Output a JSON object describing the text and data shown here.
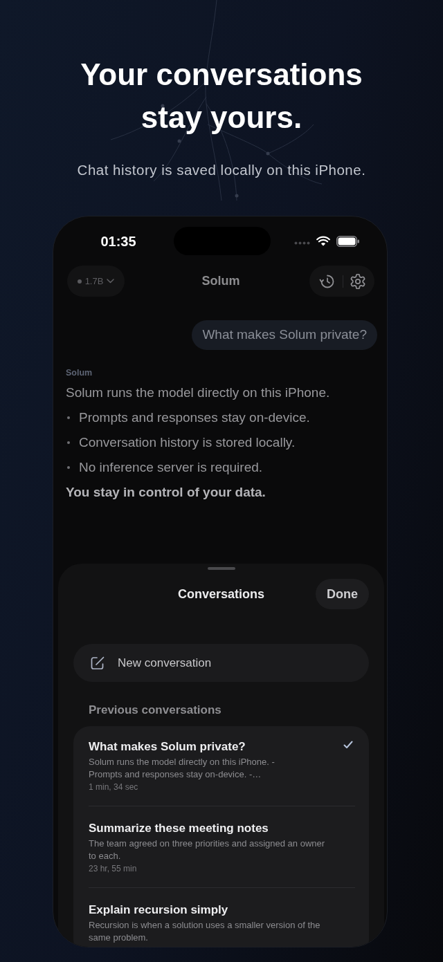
{
  "hero": {
    "title": "Your conversations stay yours.",
    "subtitle": "Chat history is saved locally on this iPhone."
  },
  "phone": {
    "status_bar": {
      "time": "01:35"
    },
    "nav_bar": {
      "model": "1.7B",
      "title": "Solum"
    },
    "user_message": {
      "text": "What makes Solum private?"
    },
    "assistant_message": {
      "sender": "Solum",
      "blocks": [
        {
          "kind": "paragraph",
          "bold": false,
          "text": "Solum runs the model directly on this iPhone."
        },
        {
          "kind": "bullet",
          "bold": false,
          "text": "Prompts and responses stay on-device."
        },
        {
          "kind": "bullet",
          "bold": false,
          "text": "Conversation history is stored locally."
        },
        {
          "kind": "bullet",
          "bold": false,
          "text": "No inference server is required."
        },
        {
          "kind": "paragraph",
          "bold": true,
          "text": "You stay in control of your data."
        }
      ]
    },
    "sheet": {
      "title": "Conversations",
      "done_button": "Done",
      "new_conversation_button": "New conversation",
      "section_title": "Previous conversations",
      "conversations": [
        {
          "title": "What makes Solum private?",
          "preview": "Solum runs the model directly on this iPhone. - Prompts and responses stay on-device. -…",
          "time": "1 min, 34 sec",
          "selected": true
        },
        {
          "title": "Summarize these meeting notes",
          "preview": "The team agreed on three priorities and assigned an owner to each.",
          "time": "23 hr, 55 min",
          "selected": false
        },
        {
          "title": "Explain recursion simply",
          "preview": "Recursion is when a solution uses a smaller version of the same problem.",
          "selected": false
        }
      ]
    }
  }
}
